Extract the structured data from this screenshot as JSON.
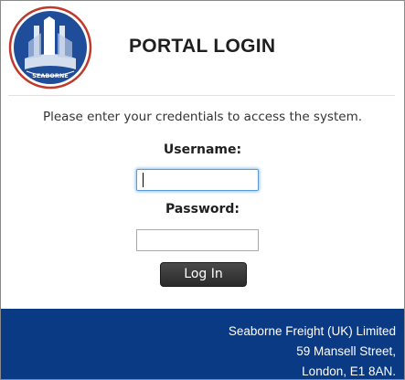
{
  "brand": {
    "logo_text": "SEABORNE",
    "colors": {
      "logo_ring": "#c0392b",
      "logo_circle": "#1f4d99",
      "footer": "#0b3a85",
      "button": "#333333"
    }
  },
  "header": {
    "title": "PORTAL LOGIN"
  },
  "form": {
    "instructions": "Please enter your credentials to access the system.",
    "username_label": "Username:",
    "username_value": "",
    "password_label": "Password:",
    "password_value": "",
    "login_label": "Log In"
  },
  "footer": {
    "line1": "Seaborne Freight (UK) Limited",
    "line2": "59 Mansell Street,",
    "line3": "London, E1 8AN."
  }
}
